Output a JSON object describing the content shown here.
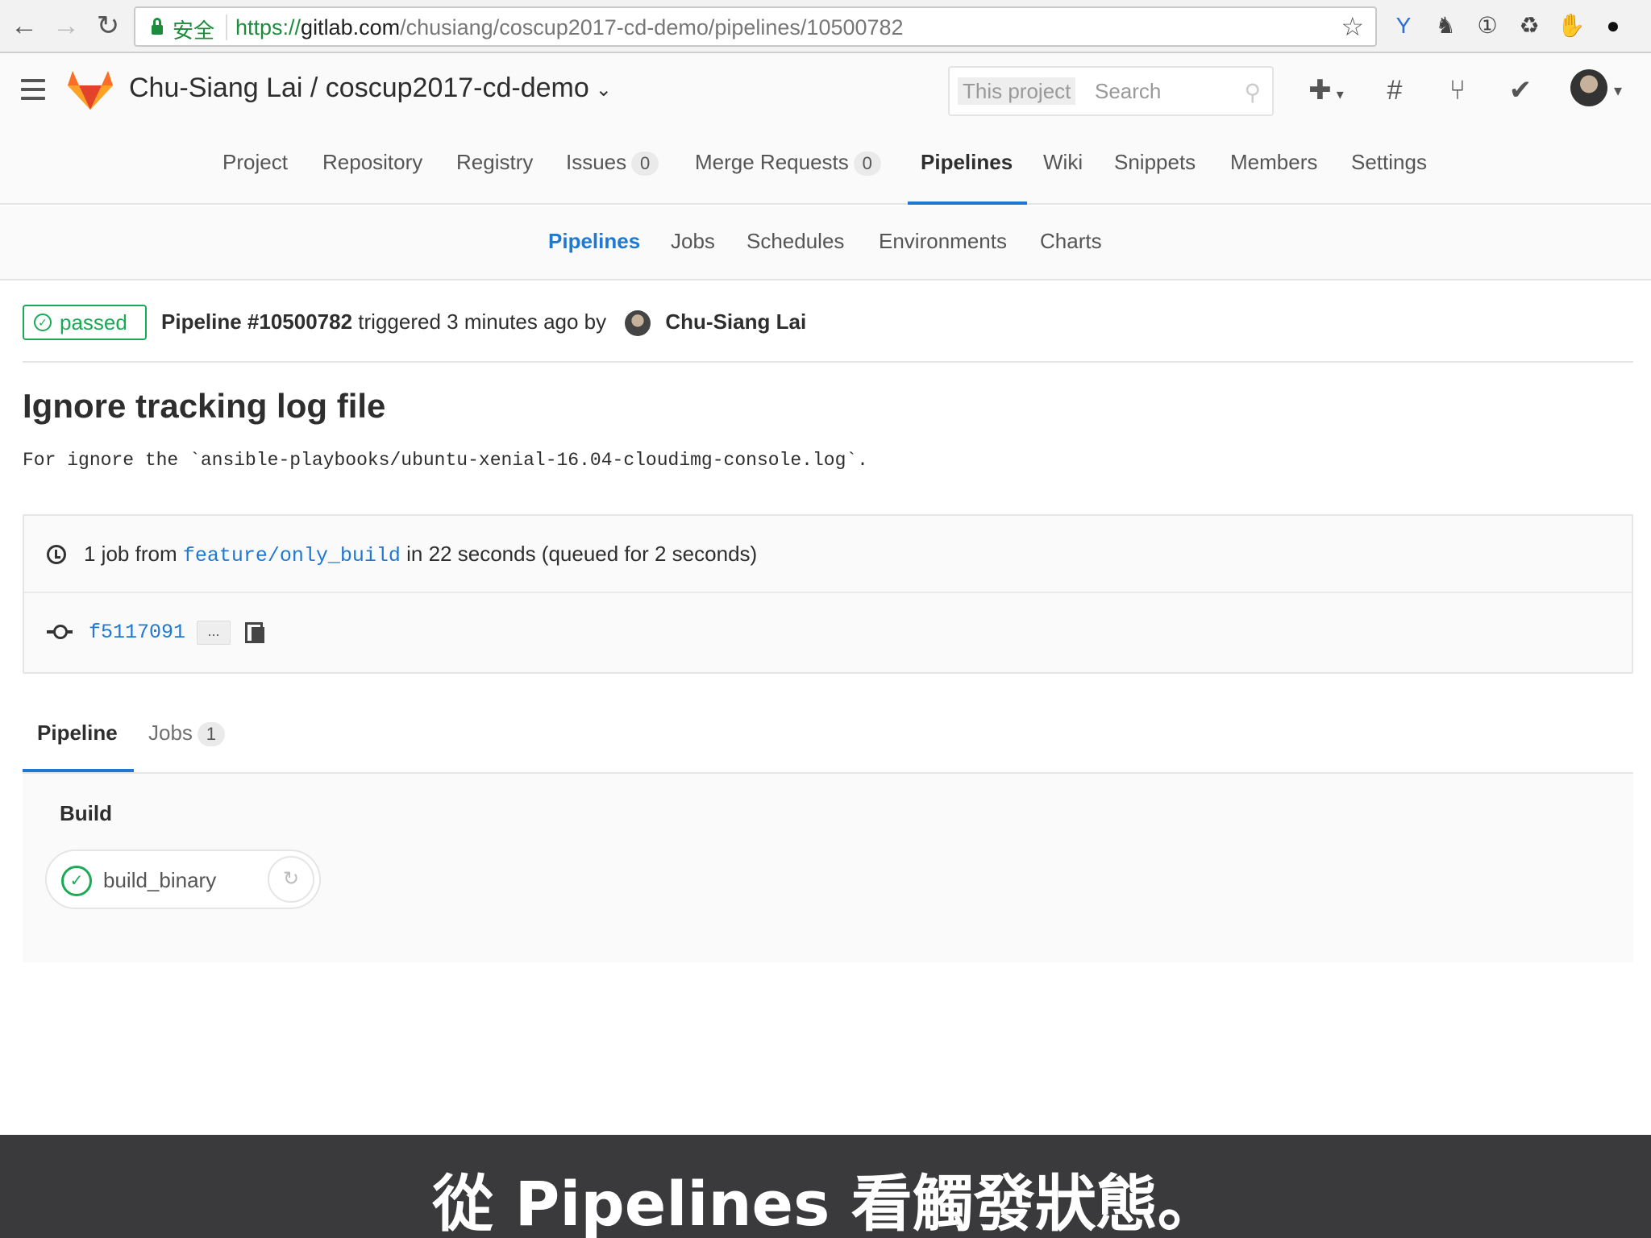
{
  "browser": {
    "secure_label": "安全",
    "url_scheme": "https://",
    "url_host": "gitlab.com",
    "url_path": "/chusiang/coscup2017-cd-demo/pipelines/10500782",
    "icons": [
      "back-icon",
      "forward-icon",
      "reload-icon",
      "bookmark-star-icon"
    ],
    "extensions": [
      "y-extension-icon",
      "evernote-icon",
      "onepassword-icon",
      "recycle-icon",
      "hand-icon",
      "hat-icon"
    ]
  },
  "header": {
    "project_title": "Chu-Siang Lai / coscup2017-cd-demo",
    "search_scope": "This project",
    "search_placeholder": "Search"
  },
  "project_nav": [
    {
      "label": "Project"
    },
    {
      "label": "Repository"
    },
    {
      "label": "Registry"
    },
    {
      "label": "Issues",
      "count": "0"
    },
    {
      "label": "Merge Requests",
      "count": "0"
    },
    {
      "label": "Pipelines",
      "active": true
    },
    {
      "label": "Wiki"
    },
    {
      "label": "Snippets"
    },
    {
      "label": "Members"
    },
    {
      "label": "Settings"
    }
  ],
  "sub_nav": [
    {
      "label": "Pipelines",
      "active": true
    },
    {
      "label": "Jobs"
    },
    {
      "label": "Schedules"
    },
    {
      "label": "Environments"
    },
    {
      "label": "Charts"
    }
  ],
  "pipeline": {
    "status": "passed",
    "id_label": "Pipeline #10500782",
    "triggered_text": "triggered 3 minutes ago by",
    "author": "Chu-Siang Lai",
    "commit_title": "Ignore tracking log file",
    "commit_description": "For ignore the `ansible-playbooks/ubuntu-xenial-16.04-cloudimg-console.log`.",
    "info_prefix": "1 job from",
    "branch": "feature/only_build",
    "info_suffix": "in 22 seconds (queued for 2 seconds)",
    "commit_sha": "f5117091",
    "ellipsis": "..."
  },
  "tabs": {
    "pipeline_label": "Pipeline",
    "jobs_label": "Jobs",
    "jobs_count": "1"
  },
  "graph": {
    "stage": "Build",
    "job_name": "build_binary",
    "job_status": "success"
  },
  "colors": {
    "accent": "#1f78d1",
    "success": "#1aaa55",
    "tanuki": "#e24329"
  },
  "subtitle": "從 Pipelines 看觸發狀態。"
}
